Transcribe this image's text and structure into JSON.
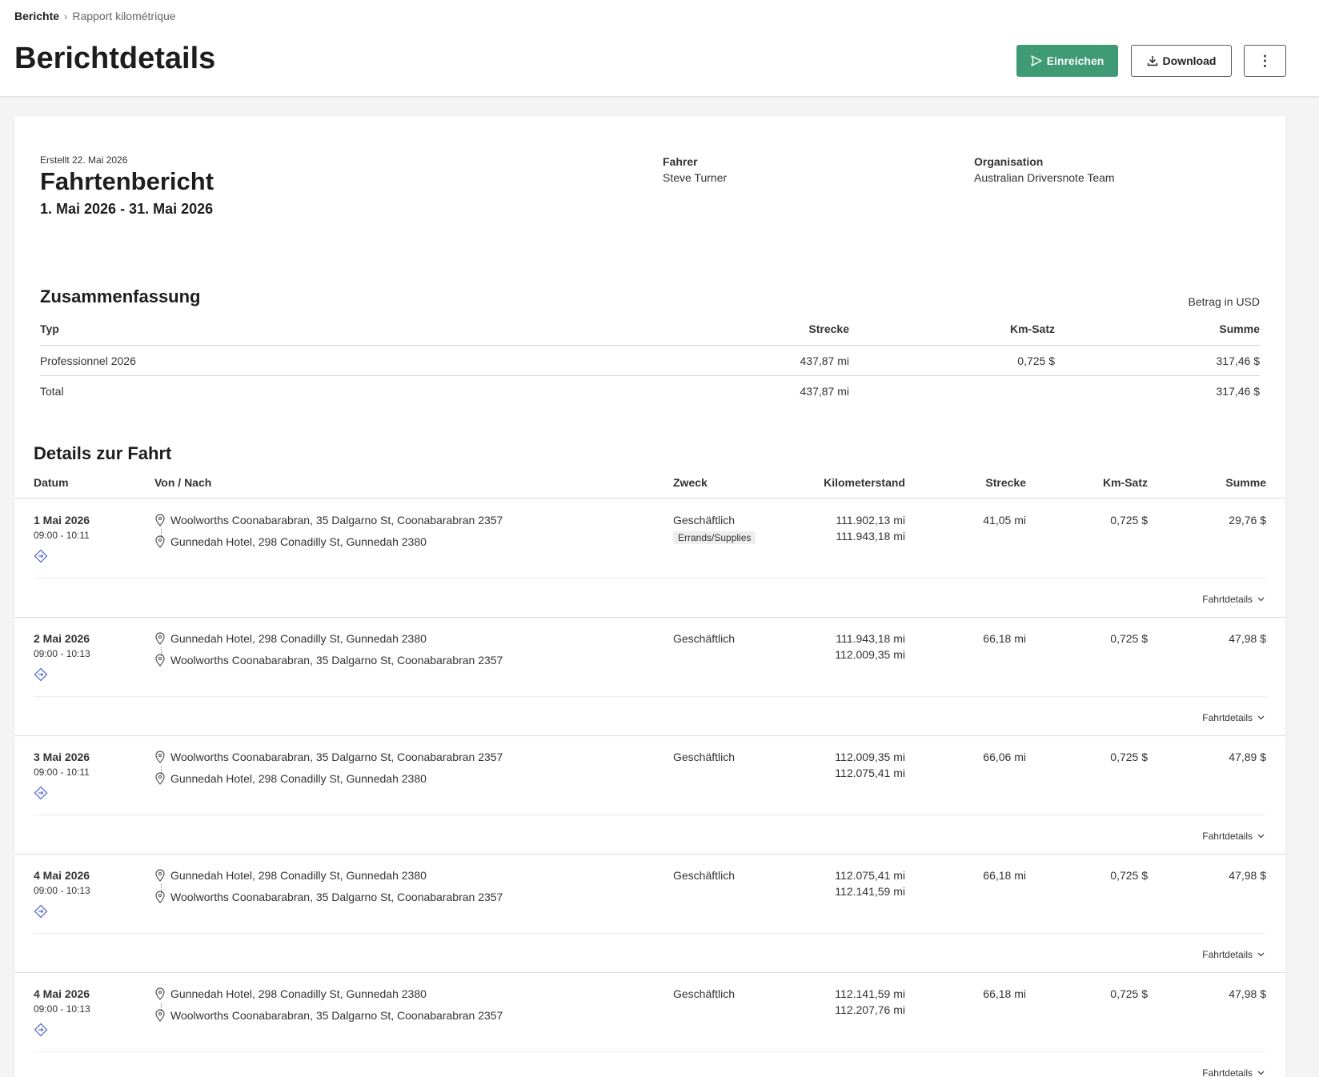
{
  "breadcrumb": {
    "root": "Berichte",
    "separator": "›",
    "current": "Rapport kilométrique"
  },
  "page_title": "Berichtdetails",
  "actions": {
    "submit": "Einreichen",
    "download": "Download",
    "more": "⋮"
  },
  "report": {
    "created": "Erstellt 22. Mai 2026",
    "title": "Fahrtenbericht",
    "range": "1. Mai 2026 - 31. Mai 2026",
    "driver_label": "Fahrer",
    "driver": "Steve Turner",
    "org_label": "Organisation",
    "org": "Australian Driversnote Team"
  },
  "summary": {
    "title": "Zusammenfassung",
    "amount_note": "Betrag in USD",
    "headers": {
      "type": "Typ",
      "distance": "Strecke",
      "rate": "Km-Satz",
      "sum": "Summe"
    },
    "rows": [
      {
        "type": "Professionnel 2026",
        "distance": "437,87 mi",
        "rate": "0,725 $",
        "sum": "317,46 $"
      }
    ],
    "total": {
      "type": "Total",
      "distance": "437,87 mi",
      "sum": "317,46 $"
    }
  },
  "trips_section": {
    "title": "Details zur Fahrt",
    "headers": {
      "date": "Datum",
      "route": "Von / Nach",
      "purpose": "Zweck",
      "odometer": "Kilometerstand",
      "distance": "Strecke",
      "rate": "Km-Satz",
      "sum": "Summe"
    },
    "details_label": "Fahrtdetails",
    "trips": [
      {
        "date": "1 Mai 2026",
        "time": "09:00 - 10:11",
        "from": "Woolworths Coonabarabran, 35 Dalgarno St, Coonabarabran 2357",
        "to": "Gunnedah Hotel, 298 Conadilly St, Gunnedah 2380",
        "purpose": "Geschäftlich",
        "tag": "Errands/Supplies",
        "odo_start": "111.902,13 mi",
        "odo_end": "111.943,18 mi",
        "distance": "41,05 mi",
        "rate": "0,725 $",
        "sum": "29,76 $"
      },
      {
        "date": "2 Mai 2026",
        "time": "09:00 - 10:13",
        "from": "Gunnedah Hotel, 298 Conadilly St, Gunnedah 2380",
        "to": "Woolworths Coonabarabran, 35 Dalgarno St, Coonabarabran 2357",
        "purpose": "Geschäftlich",
        "tag": "",
        "odo_start": "111.943,18 mi",
        "odo_end": "112.009,35 mi",
        "distance": "66,18 mi",
        "rate": "0,725 $",
        "sum": "47,98 $"
      },
      {
        "date": "3 Mai 2026",
        "time": "09:00 - 10:11",
        "from": "Woolworths Coonabarabran, 35 Dalgarno St, Coonabarabran 2357",
        "to": "Gunnedah Hotel, 298 Conadilly St, Gunnedah 2380",
        "purpose": "Geschäftlich",
        "tag": "",
        "odo_start": "112.009,35 mi",
        "odo_end": "112.075,41 mi",
        "distance": "66,06 mi",
        "rate": "0,725 $",
        "sum": "47,89 $"
      },
      {
        "date": "4 Mai 2026",
        "time": "09:00 - 10:13",
        "from": "Gunnedah Hotel, 298 Conadilly St, Gunnedah 2380",
        "to": "Woolworths Coonabarabran, 35 Dalgarno St, Coonabarabran 2357",
        "purpose": "Geschäftlich",
        "tag": "",
        "odo_start": "112.075,41 mi",
        "odo_end": "112.141,59 mi",
        "distance": "66,18 mi",
        "rate": "0,725 $",
        "sum": "47,98 $"
      },
      {
        "date": "4 Mai 2026",
        "time": "09:00 - 10:13",
        "from": "Gunnedah Hotel, 298 Conadilly St, Gunnedah 2380",
        "to": "Woolworths Coonabarabran, 35 Dalgarno St, Coonabarabran 2357",
        "purpose": "Geschäftlich",
        "tag": "",
        "odo_start": "112.141,59 mi",
        "odo_end": "112.207,76 mi",
        "distance": "66,18 mi",
        "rate": "0,725 $",
        "sum": "47,98 $"
      }
    ]
  },
  "colors": {
    "primary": "#3f9b76",
    "trip_icon": "#5b6fd6"
  }
}
